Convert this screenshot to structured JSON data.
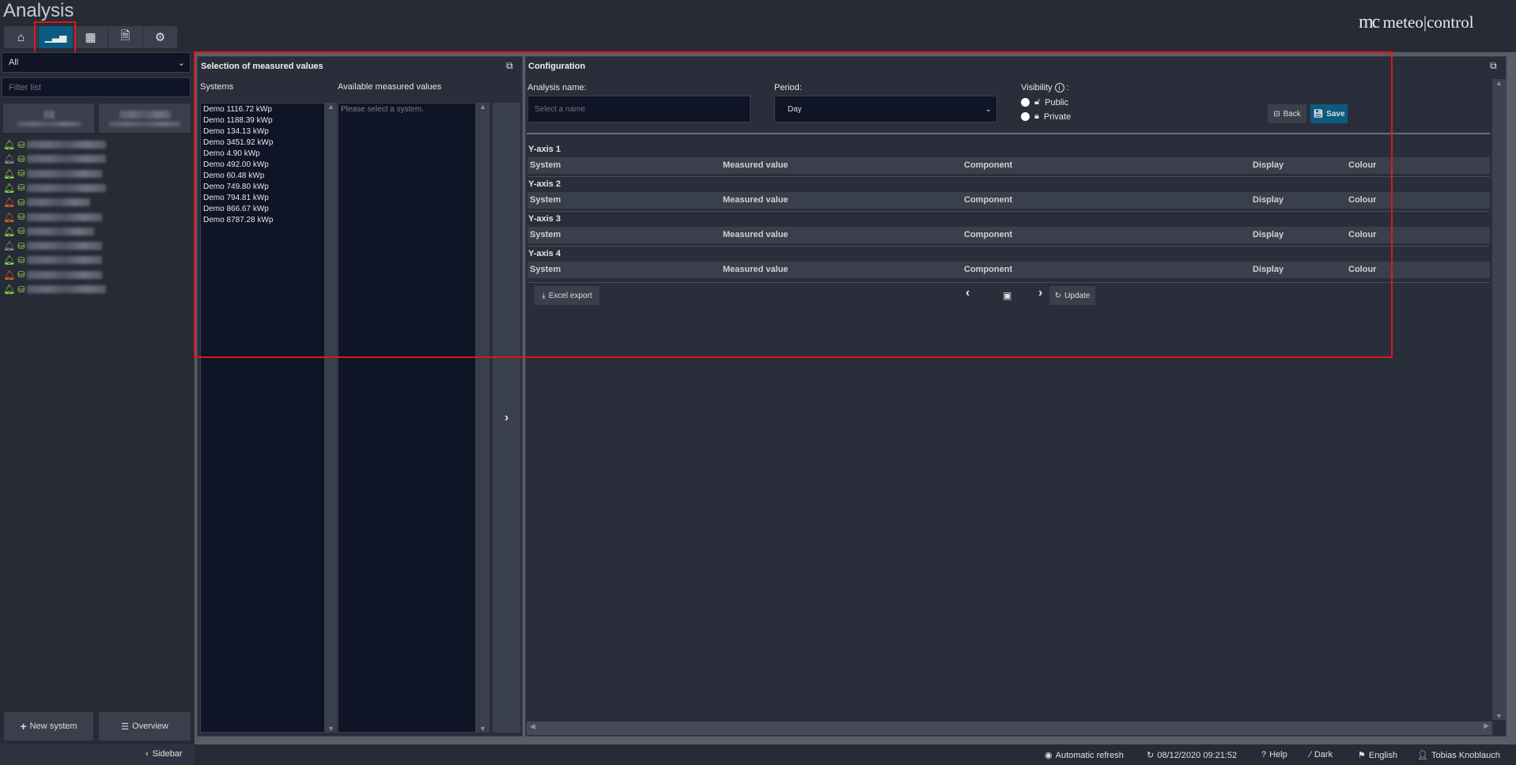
{
  "header": {
    "title": "Analysis",
    "logo_text": "meteo|control"
  },
  "nav_tabs": [
    {
      "icon": "home-icon"
    },
    {
      "icon": "chart-icon",
      "active": true
    },
    {
      "icon": "calendar-icon"
    },
    {
      "icon": "document-icon"
    },
    {
      "icon": "gear-icon"
    }
  ],
  "sidebar": {
    "filter_select": "All",
    "filter_placeholder": "Filter list",
    "system_status": [
      "green",
      "gray",
      "green",
      "green",
      "orange",
      "orange",
      "green",
      "gray",
      "green",
      "orange",
      "green"
    ],
    "new_system": "New system",
    "overview": "Overview",
    "toggle": "Sidebar"
  },
  "selection": {
    "title": "Selection of measured values",
    "systems_label": "Systems",
    "available_label": "Available measured values",
    "systems": [
      "Demo 1116.72 kWp",
      "Demo 1188.39 kWp",
      "Demo 134.13 kWp",
      "Demo 3451.92 kWp",
      "Demo 4.90 kWp",
      "Demo 492.00 kWp",
      "Demo 60.48 kWp",
      "Demo 749.80 kWp",
      "Demo 794.81 kWp",
      "Demo 866.67 kWp",
      "Demo 8787.28 kWp"
    ],
    "available_placeholder": "Please select a system."
  },
  "config": {
    "title": "Configuration",
    "name_label": "Analysis name:",
    "name_placeholder": "Select a name",
    "period_label": "Period:",
    "period_value": "Day",
    "visibility_label": "Visibility",
    "public": "Public",
    "private": "Private",
    "back": "Back",
    "save": "Save",
    "axes": [
      {
        "label": "Y-axis 1"
      },
      {
        "label": "Y-axis 2"
      },
      {
        "label": "Y-axis 3"
      },
      {
        "label": "Y-axis 4"
      }
    ],
    "columns": [
      "System",
      "Measured value",
      "Component",
      "Display",
      "Colour"
    ],
    "excel_export": "Excel export",
    "update": "Update"
  },
  "status_bar": {
    "auto_refresh": "Automatic refresh",
    "datetime": "08/12/2020 09:21:52",
    "help": "Help",
    "theme": "Dark",
    "language": "English",
    "user": "Tobias Knoblauch"
  },
  "colors": {
    "accent": "#0b5a80",
    "highlight": "#e0161a",
    "ok": "#9be34a",
    "warn": "#f06a1e",
    "neutral": "#9a9a9a"
  }
}
